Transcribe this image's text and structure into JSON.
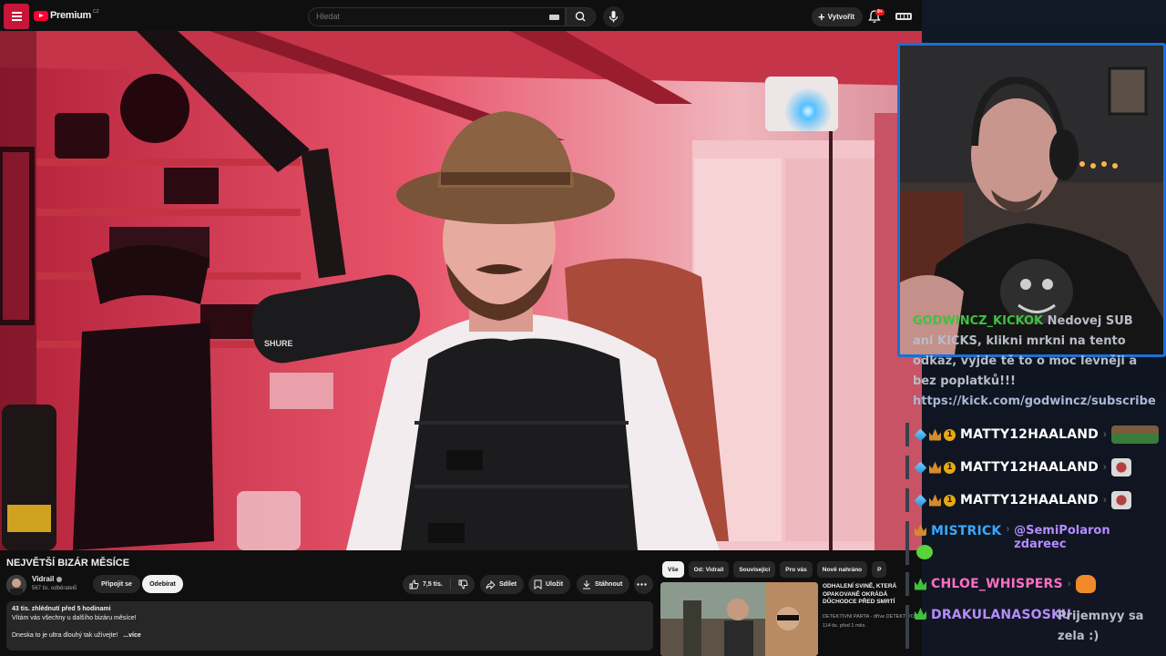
{
  "topbar": {
    "logo_text": "Premium",
    "logo_region": "CZ",
    "search_placeholder": "Hledat",
    "create_label": "Vytvořit",
    "notification_badge": "9+"
  },
  "video": {
    "title": "NEJVĚTŠÍ BIZÁR MĚSÍCE",
    "channel": "Vidrail",
    "subscribers": "567 tis. odběratelů",
    "join_label": "Připojit se",
    "subscribe_label": "Odebírat",
    "likes": "7,5 tis.",
    "share_label": "Sdílet",
    "save_label": "Uložit",
    "download_label": "Stáhnout",
    "microphone_brand": "SHURE"
  },
  "description": {
    "meta": "43 tis. zhlédnutí  před 5 hodinami",
    "line1": "Vítám vás všechny u dalšího bizáru měsíce!",
    "line2": "Dneska to je ultra dlouhý tak užívejte!",
    "more_label": "...více"
  },
  "chips": [
    "Vše",
    "Od: Vidrail",
    "Související",
    "Pro vás",
    "Nově nahráno",
    "P"
  ],
  "recommendation": {
    "title": "ODHALENÍ SVINĚ, KTERÁ OPAKOVANĚ OKRÁDÁ DŮCHODCE PŘED SMRTÍ",
    "channel": "DETEKTIVNÍ PARTA - dříve DETEKTIVOVÉ",
    "stats": "114 tis.  před 1 měs."
  },
  "chat": {
    "sub_user": "GODWINCZ_KICKOK",
    "sub_text": "Nedovej SUB ani KICKS, klikni mrkni na tento odkaz, vyjde tě to o moc levněji a bez poplatků!!!",
    "sub_link": "https://kick.com/godwincz/subscribe",
    "messages": [
      {
        "user": "MATTY12HAALAND",
        "color": "#ffffff",
        "text": ""
      },
      {
        "user": "MATTY12HAALAND",
        "color": "#ffffff",
        "text": ""
      },
      {
        "user": "MATTY12HAALAND",
        "color": "#ffffff",
        "text": ""
      },
      {
        "user": "MISTRICK",
        "color": "#3aa8ff",
        "text": "@SemiPolaron zdareec",
        "mention_color": "#b48cff"
      },
      {
        "user": "CHLOE_WHISPERS",
        "color": "#ff6fc4",
        "text": ""
      },
      {
        "user": "DRAKULANASOSKU",
        "color": "#b48cff",
        "text": "Prijemnyy sa zela :)"
      }
    ]
  },
  "colors": {
    "yt_bg": "#0f0f0f",
    "yt_red": "#ff0033",
    "webcam_border": "#1c6fd8",
    "chat_text": "#b7bcc6"
  }
}
